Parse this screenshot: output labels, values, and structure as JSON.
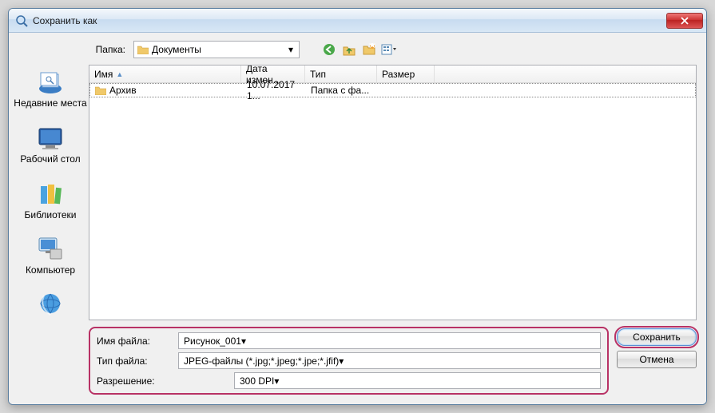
{
  "title": "Сохранить как",
  "folder": {
    "label": "Папка:",
    "value": "Документы"
  },
  "columns": {
    "name": "Имя",
    "date": "Дата измен...",
    "type": "Тип",
    "size": "Размер"
  },
  "rows": [
    {
      "name": "Архив",
      "date": "10.07.2017 1...",
      "type": "Папка с фа...",
      "size": ""
    }
  ],
  "places": {
    "recent": "Недавние места",
    "desktop": "Рабочий стол",
    "libraries": "Библиотеки",
    "computer": "Компьютер",
    "network": ""
  },
  "fields": {
    "filename_label": "Имя файла:",
    "filename_value": "Рисунок_001",
    "filetype_label": "Тип файла:",
    "filetype_value": "JPEG-файлы (*.jpg;*.jpeg;*.jpe;*.jfif)",
    "resolution_label": "Разрешение:",
    "resolution_value": "300 DPI"
  },
  "buttons": {
    "save": "Сохранить",
    "cancel": "Отмена"
  }
}
